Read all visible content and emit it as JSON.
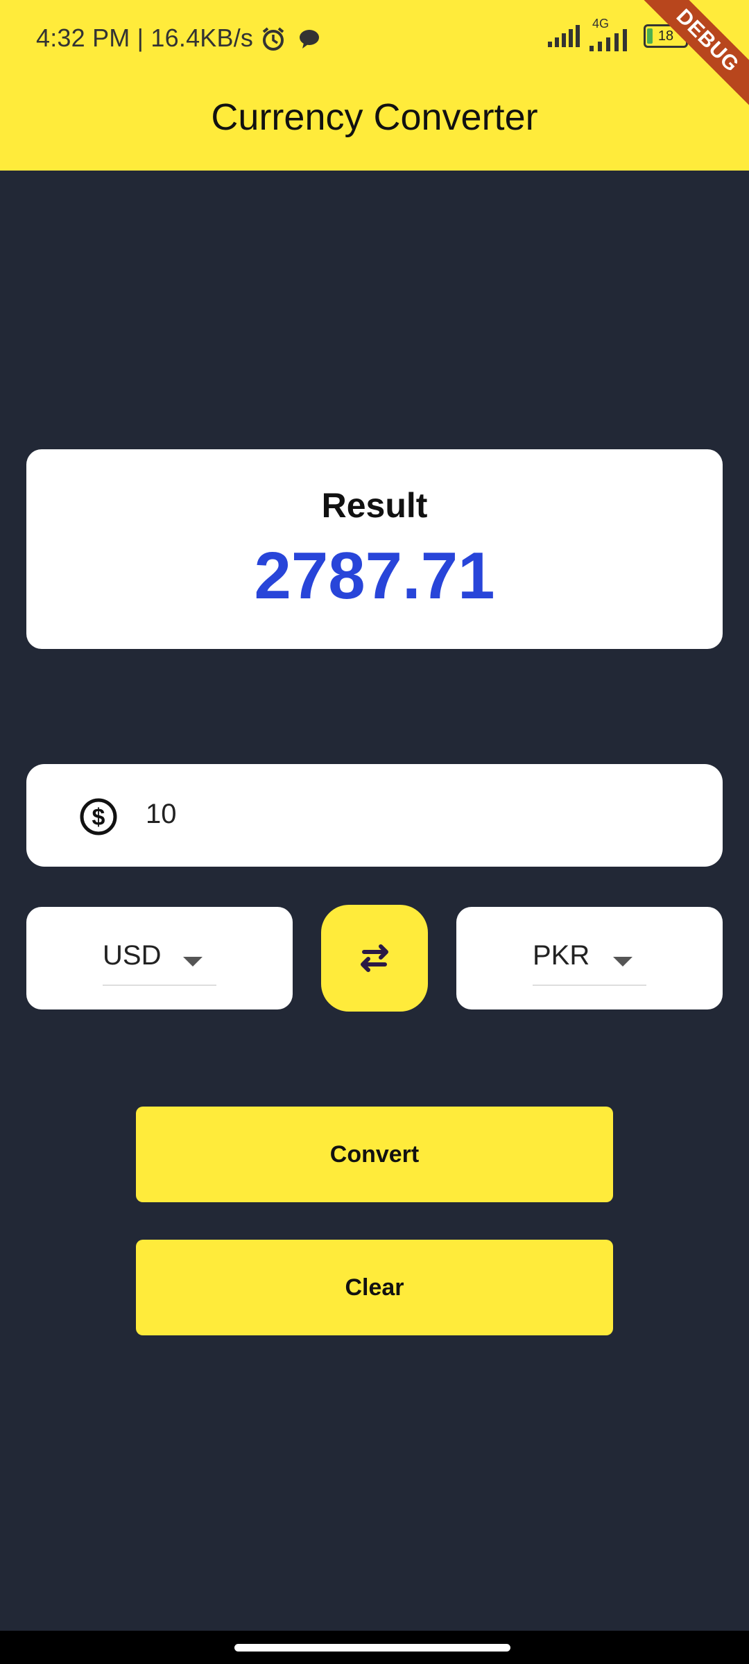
{
  "status_bar": {
    "time_and_speed": "4:32 PM | 16.4KB/s",
    "network": "4G",
    "battery": "18",
    "debug_badge": "DEBUG"
  },
  "app_bar": {
    "title": "Currency Converter"
  },
  "result": {
    "label": "Result",
    "value": "2787.71"
  },
  "amount": {
    "value": "10",
    "icon": "dollar-circle-icon"
  },
  "currencies": {
    "from": "USD",
    "to": "PKR",
    "swap_icon": "swap-icon"
  },
  "buttons": {
    "convert": "Convert",
    "clear": "Clear"
  },
  "colors": {
    "appbar": "#FFEB3B",
    "background": "#222836",
    "result_value": "#2845D9",
    "card": "#FFFFFF"
  }
}
